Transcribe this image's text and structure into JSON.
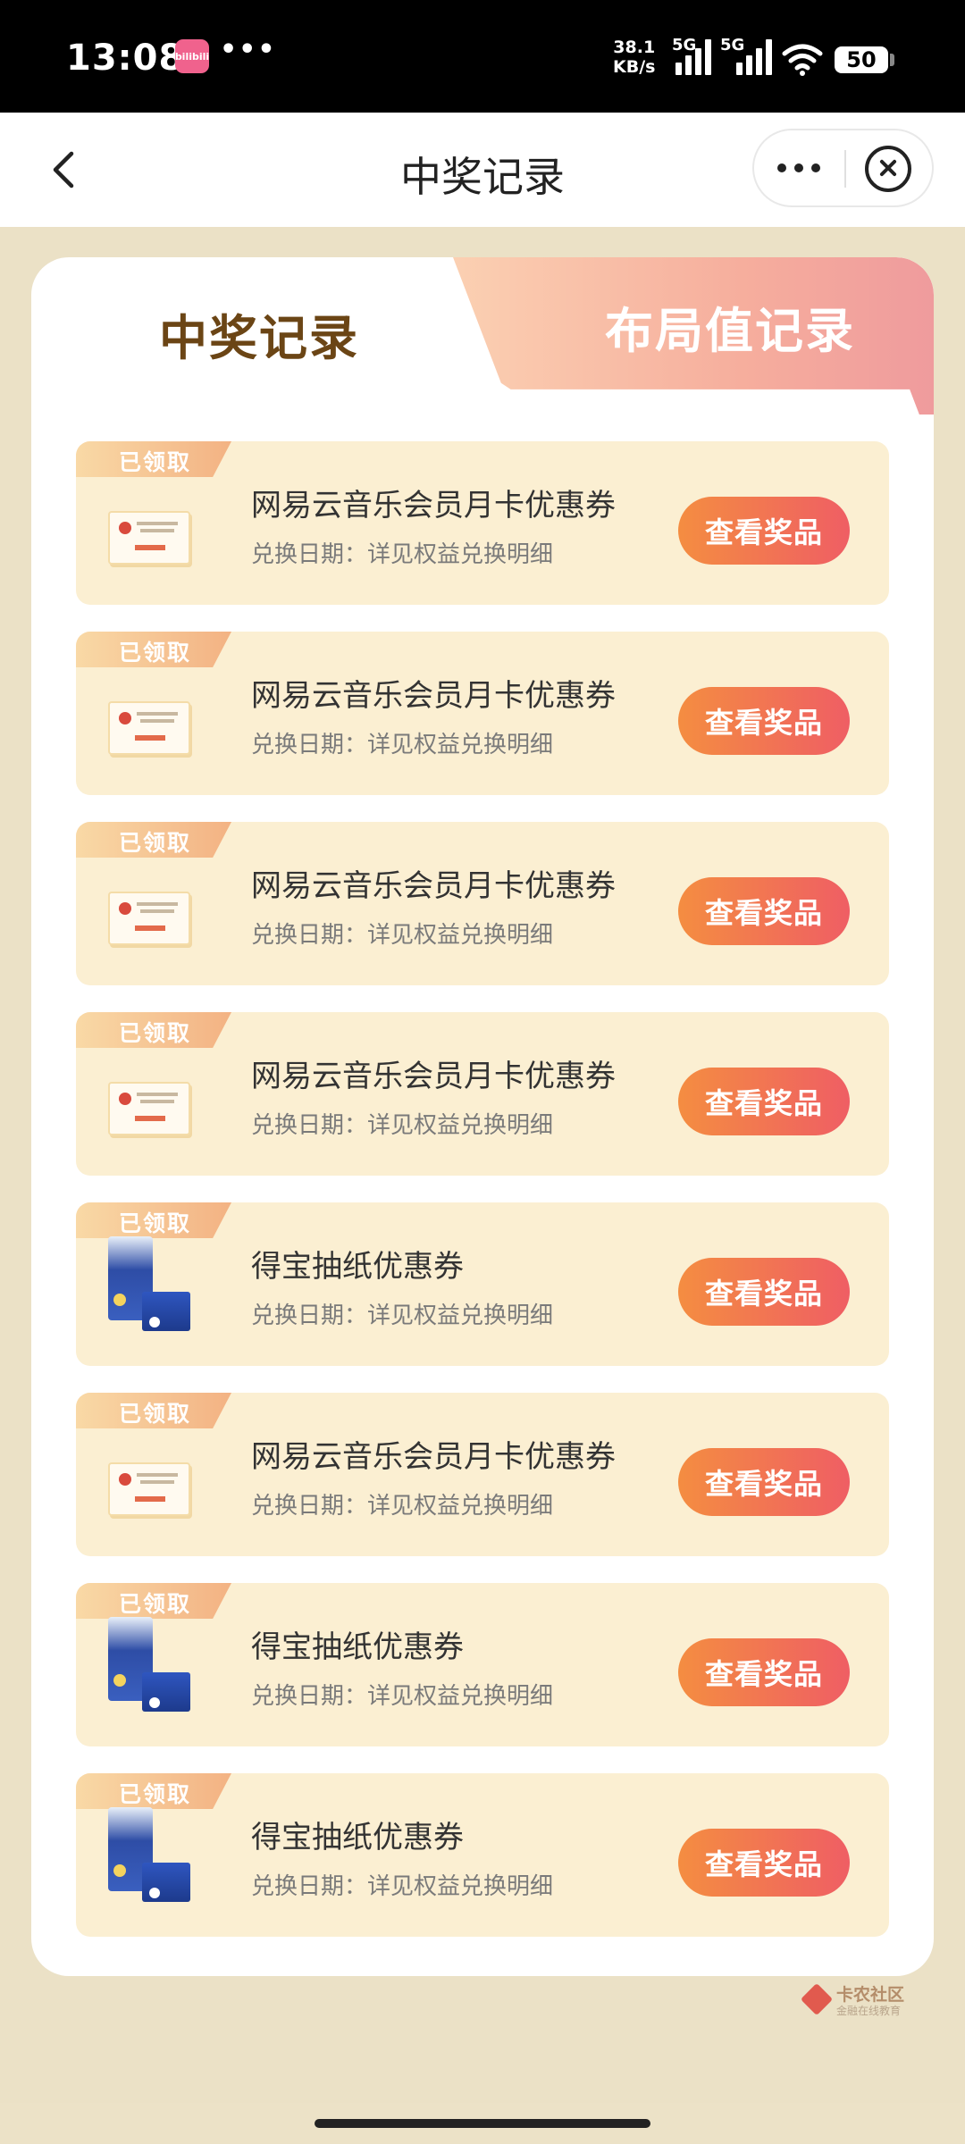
{
  "status_bar": {
    "time": "13:08",
    "app_badge": "bilibili",
    "dots": "•••",
    "net_speed_value": "38.1",
    "net_speed_unit": "KB/s",
    "sim1_label": "5G",
    "sim2_label": "5G",
    "battery": "50"
  },
  "nav": {
    "title": "中奖记录",
    "back_icon": "chevron-left-icon",
    "more_icon": "more-icon",
    "close_icon": "close-circle-icon"
  },
  "tabs": {
    "active": "中奖记录",
    "inactive": "布局值记录"
  },
  "records": [
    {
      "badge": "已领取",
      "title": "网易云音乐会员月卡优惠券",
      "date_text": "兑换日期：详见权益兑换明细",
      "button": "查看奖品",
      "image": "coupon"
    },
    {
      "badge": "已领取",
      "title": "网易云音乐会员月卡优惠券",
      "date_text": "兑换日期：详见权益兑换明细",
      "button": "查看奖品",
      "image": "coupon"
    },
    {
      "badge": "已领取",
      "title": "网易云音乐会员月卡优惠券",
      "date_text": "兑换日期：详见权益兑换明细",
      "button": "查看奖品",
      "image": "coupon"
    },
    {
      "badge": "已领取",
      "title": "网易云音乐会员月卡优惠券",
      "date_text": "兑换日期：详见权益兑换明细",
      "button": "查看奖品",
      "image": "coupon"
    },
    {
      "badge": "已领取",
      "title": "得宝抽纸优惠券",
      "date_text": "兑换日期：详见权益兑换明细",
      "button": "查看奖品",
      "image": "tissue"
    },
    {
      "badge": "已领取",
      "title": "网易云音乐会员月卡优惠券",
      "date_text": "兑换日期：详见权益兑换明细",
      "button": "查看奖品",
      "image": "coupon"
    },
    {
      "badge": "已领取",
      "title": "得宝抽纸优惠券",
      "date_text": "兑换日期：详见权益兑换明细",
      "button": "查看奖品",
      "image": "tissue"
    },
    {
      "badge": "已领取",
      "title": "得宝抽纸优惠券",
      "date_text": "兑换日期：详见权益兑换明细",
      "button": "查看奖品",
      "image": "tissue"
    }
  ],
  "watermark": {
    "main": "卡农社区",
    "sub": "金融在线教育"
  },
  "colors": {
    "page_bg": "#ebe1c6",
    "card_bg": "#fbefd2",
    "button_start": "#f48d41",
    "button_end": "#ef5e64",
    "active_tab_text": "#6b4515"
  }
}
